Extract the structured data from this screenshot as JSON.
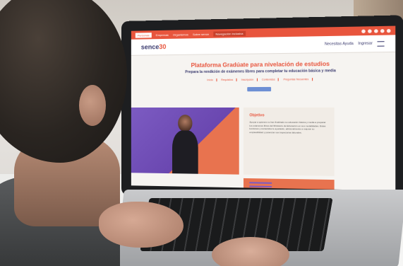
{
  "site": {
    "nav_items": [
      "Personas",
      "Empresas",
      "Organismos",
      "Sobre sence",
      "Navegación inclusiva"
    ],
    "logo_main": "sence",
    "logo_suffix": "30",
    "help_label": "Necesitas Ayuda",
    "login_label": "Ingresar",
    "title": "Plataforma Gradúate para nivelación de estudios",
    "subtitle": "Prepara la rendición de exámenes libres para completar tu educación básica y media",
    "links": [
      "Inicio",
      "Requisitos",
      "Inscripción",
      "Contenidos",
      "Preguntas frecuentes"
    ],
    "objectives_title": "Objetivo",
    "objectives_text": "Apoyar a quienes no han finalizado su educación básica y media a preparar los exámenes libres del Ministerio de Educación en sus modalidades. Estas lecciones y contenidos le ayudarán, adicionalmente a mejorar su empleabilidad y potenciar sus trayectorias laborales."
  },
  "colors": {
    "brand_orange": "#e8553d",
    "brand_purple": "#7c5bc2",
    "brand_navy": "#3a3a6e"
  }
}
